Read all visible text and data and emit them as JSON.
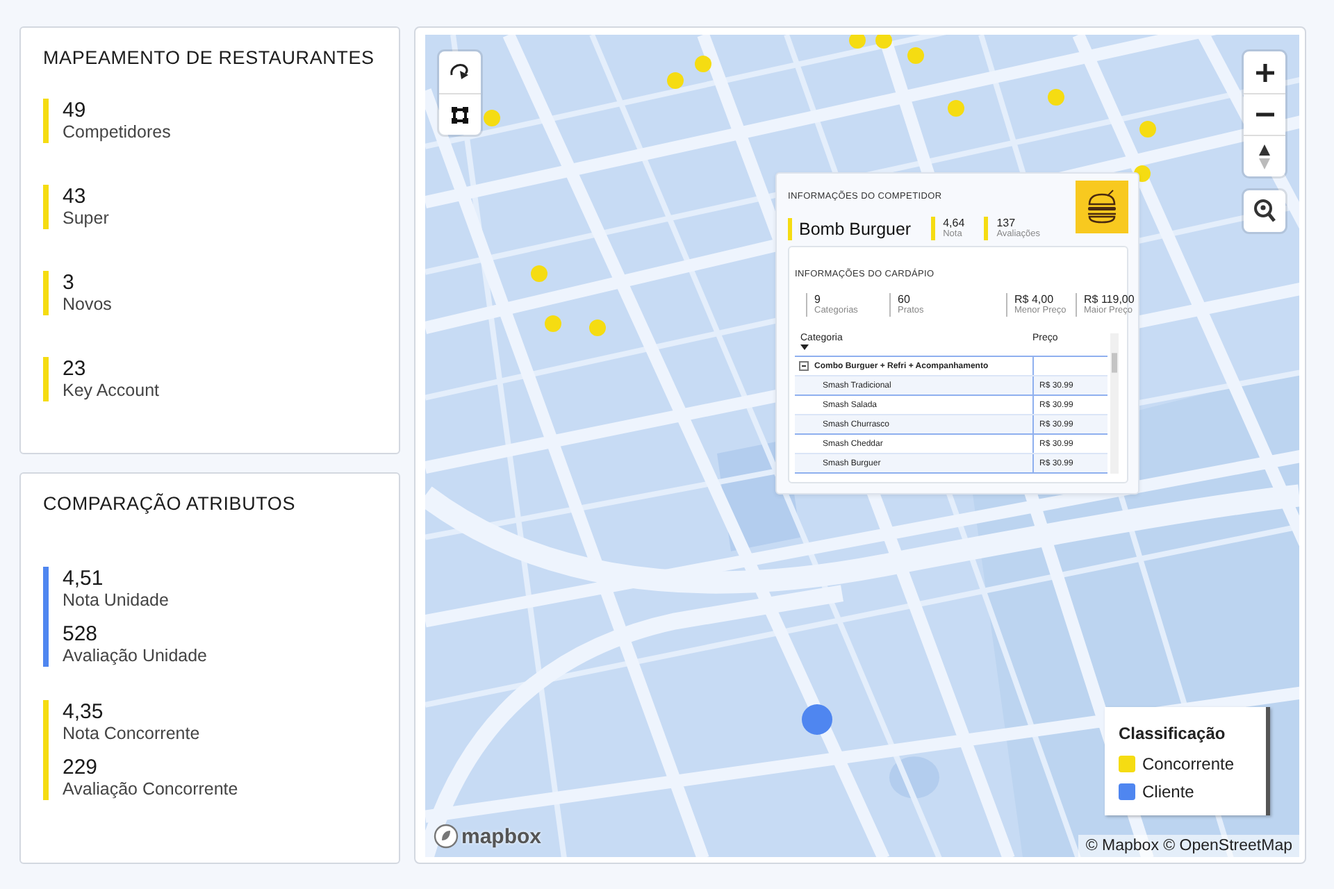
{
  "summary_panel": {
    "title": "MAPEAMENTO DE RESTAURANTES",
    "stats": [
      {
        "value": "49",
        "label": "Competidores"
      },
      {
        "value": "43",
        "label": "Super"
      },
      {
        "value": "3",
        "label": "Novos"
      },
      {
        "value": "23",
        "label": "Key Account"
      }
    ]
  },
  "comparison_panel": {
    "title": "COMPARAÇÃO ATRIBUTOS",
    "groups": [
      {
        "color": "#4f86f0",
        "stats": [
          {
            "value": "4,51",
            "label": "Nota Unidade"
          },
          {
            "value": "528",
            "label": "Avaliação Unidade"
          }
        ]
      },
      {
        "color": "#f5dc12",
        "stats": [
          {
            "value": "4,35",
            "label": "Nota Concorrente"
          },
          {
            "value": "229",
            "label": "Avaliação Concorrente"
          }
        ]
      }
    ]
  },
  "map": {
    "kind": "picture",
    "popup": {
      "header": "INFORMAÇÕES DO COMPETIDOR",
      "name": "Bomb Burguer",
      "metrics": [
        {
          "value": "4,64",
          "label": "Nota"
        },
        {
          "value": "137",
          "label": "Avaliações"
        }
      ],
      "menu": {
        "title": "INFORMAÇÕES DO CARDÁPIO",
        "stats": [
          {
            "value": "9",
            "label": "Categorias"
          },
          {
            "value": "60",
            "label": "Pratos"
          },
          {
            "value": "R$ 4,00",
            "label": "Menor Preço"
          },
          {
            "value": "R$ 119,00",
            "label": "Maior Preço"
          }
        ],
        "table": {
          "columns": [
            "Categoria",
            "Preço"
          ],
          "rows": [
            {
              "kind": "group",
              "name": "Combo Burguer + Refri + Acompanhamento",
              "expanded": true
            },
            {
              "kind": "item",
              "name": "Smash Tradicional",
              "price": "R$ 30.99"
            },
            {
              "kind": "item",
              "name": "Smash Salada",
              "price": "R$ 30.99"
            },
            {
              "kind": "item",
              "name": "Smash Churrasco",
              "price": "R$ 30.99"
            },
            {
              "kind": "item",
              "name": "Smash Cheddar",
              "price": "R$ 30.99"
            },
            {
              "kind": "item",
              "name": "Smash Burguer",
              "price": "R$ 30.99"
            }
          ]
        }
      }
    },
    "legend": {
      "title": "Classificação",
      "items": [
        {
          "label": "Concorrente",
          "color": "#f5dc12"
        },
        {
          "label": "Cliente",
          "color": "#4f86f0"
        }
      ]
    },
    "logo": "mapbox",
    "attribution": "© Mapbox © OpenStreetMap"
  }
}
